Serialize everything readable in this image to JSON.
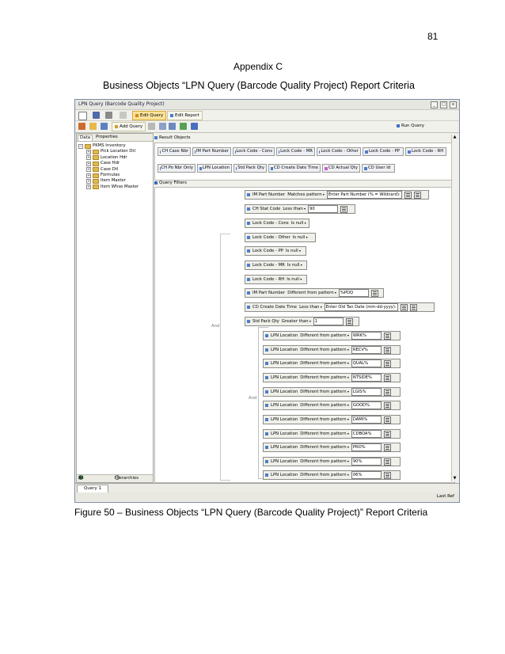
{
  "page": {
    "number": "81",
    "heading": "Appendix C",
    "subtitle": "Business Objects “LPN Query (Barcode Quality Project) Report Criteria",
    "caption": "Figure 50 – Business Objects “LPN Query (Barcode Quality Project)” Report Criteria"
  },
  "window": {
    "title": "LPN Query (Barcode Quality Project)",
    "controls": [
      "_",
      "□",
      "x"
    ],
    "toolbar1": {
      "edit_query": "Edit Query",
      "edit_report": "Edit Report"
    },
    "toolbar2": {
      "add_query": "Add Query",
      "run_query": "Run Query"
    },
    "left_tabs": [
      "Data",
      "Properties"
    ],
    "tree": {
      "root": "PKMS Inventory",
      "children": [
        "Pick Location Dtl",
        "Location Hdr",
        "Case Hdr",
        "Case Dtl",
        "Formulas",
        "Item Master",
        "Item Whse Master"
      ]
    },
    "left_footer": {
      "all_objects": "All Objects",
      "hierarchies": "Hierarchies"
    },
    "result_objects_label": "Result Objects",
    "result_objects": [
      "CH Case Nbr",
      "IM Part Number",
      "Lock Code - Cons",
      "Lock Code - MR",
      "Lock Code - Other",
      "Lock Code - PP",
      "Lock Code - RH",
      "CH Po Nbr Only",
      "LPN Location",
      "Std Pack Qty",
      "CD Create Date Time",
      "CD Actual Qty",
      "CD User Id"
    ],
    "query_filters_label": "Query Filters",
    "and_label": "And",
    "filters": [
      {
        "field": "IM Part Number",
        "op": "Matches pattern",
        "value": "Enter Part Number (% = Wildcard):"
      },
      {
        "field": "CH Stat Code",
        "op": "Less than",
        "value": "90"
      },
      {
        "field": "Lock Code - Cons",
        "op": "Is null",
        "value": ""
      },
      {
        "field": "Lock Code - Other",
        "op": "Is null",
        "value": ""
      },
      {
        "field": "Lock Code - PP",
        "op": "Is null",
        "value": ""
      },
      {
        "field": "Lock Code - MR",
        "op": "Is null",
        "value": ""
      },
      {
        "field": "Lock Code - RH",
        "op": "Is null",
        "value": ""
      },
      {
        "field": "IM Part Number",
        "op": "Different from pattern",
        "value": "%PDQ"
      },
      {
        "field": "CD Create Date Time",
        "op": "Less than",
        "value": "Enter Old Tan Date (mm-dd-yyyy):"
      },
      {
        "field": "Std Pack Qty",
        "op": "Greater than",
        "value": "1"
      }
    ],
    "location_filters": [
      {
        "field": "LPN Location",
        "op": "Different from pattern",
        "value": "WRK%"
      },
      {
        "field": "LPN Location",
        "op": "Different from pattern",
        "value": "RECV%"
      },
      {
        "field": "LPN Location",
        "op": "Different from pattern",
        "value": "QUAL%"
      },
      {
        "field": "LPN Location",
        "op": "Different from pattern",
        "value": "NTSIDE%"
      },
      {
        "field": "LPN Location",
        "op": "Different from pattern",
        "value": "LGIS%"
      },
      {
        "field": "LPN Location",
        "op": "Different from pattern",
        "value": "GOOD%"
      },
      {
        "field": "LPN Location",
        "op": "Different from pattern",
        "value": "DAMI%"
      },
      {
        "field": "LPN Location",
        "op": "Different from pattern",
        "value": "CDBOA%"
      },
      {
        "field": "LPN Location",
        "op": "Different from pattern",
        "value": "PRO%"
      },
      {
        "field": "LPN Location",
        "op": "Different from pattern",
        "value": "90%"
      },
      {
        "field": "LPN Location",
        "op": "Different from pattern",
        "value": "06%"
      }
    ],
    "query_tab": "Query 1",
    "status": "Last Ref"
  }
}
